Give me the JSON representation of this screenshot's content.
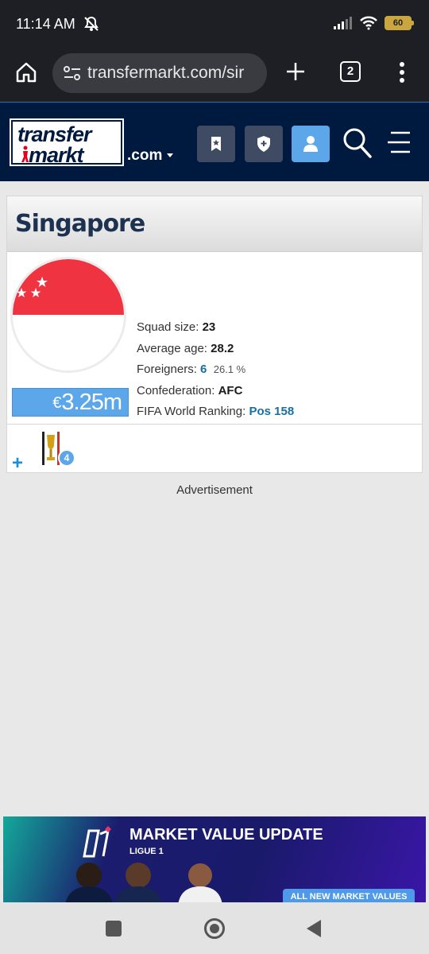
{
  "status_bar": {
    "time": "11:14 AM",
    "battery": "60"
  },
  "browser": {
    "url": "transfermarkt.com/sir",
    "tab_count": "2"
  },
  "site": {
    "logo_line1": "transfer",
    "logo_line2": "markt",
    "domain_suffix": ".com"
  },
  "team": {
    "name": "Singapore",
    "market_value_currency": "€",
    "market_value": "3.25m",
    "squad_size_label": "Squad size:",
    "squad_size": "23",
    "average_age_label": "Average age:",
    "average_age": "28.2",
    "foreigners_label": "Foreigners:",
    "foreigners": "6",
    "foreigners_pct": "26.1 %",
    "confederation_label": "Confederation:",
    "confederation": "AFC",
    "fifa_ranking_label": "FIFA World Ranking:",
    "fifa_ranking": "Pos 158",
    "trophy_count": "4"
  },
  "advertisement_label": "Advertisement",
  "ad_banner": {
    "title": "MARKET VALUE UPDATE",
    "subtitle": "LIGUE 1",
    "cta": "ALL NEW MARKET VALUES"
  },
  "colors": {
    "header_bg": "#00193f",
    "accent": "#5ca7ea",
    "link": "#1a6fa0",
    "flag_red": "#ef3340"
  }
}
